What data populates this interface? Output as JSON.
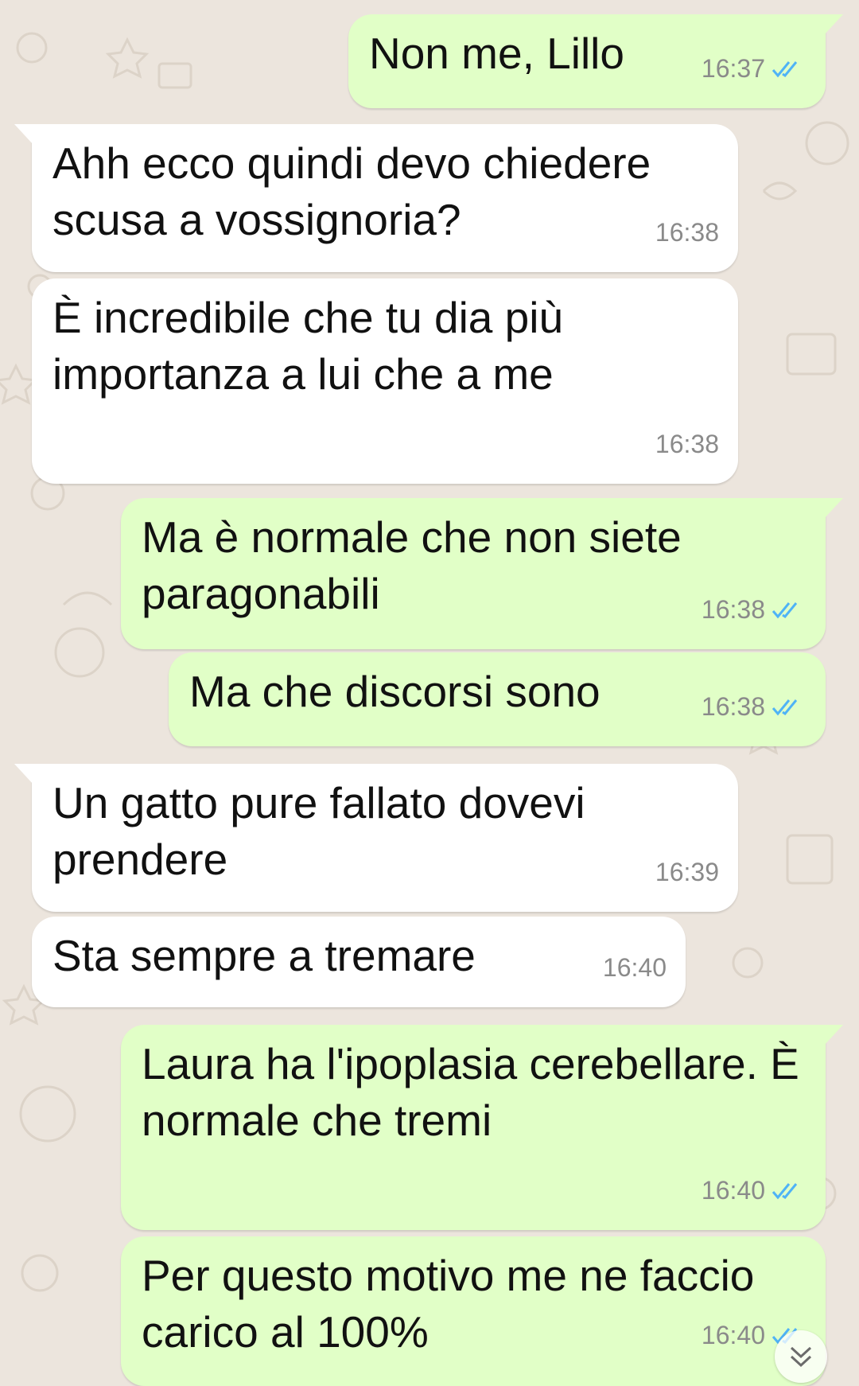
{
  "colors": {
    "wallpaper": "#ece5dd",
    "incoming_bubble": "#ffffff",
    "outgoing_bubble": "#e1ffc7",
    "timestamp": "#8a8a8a",
    "read_ticks": "#4fb3f6"
  },
  "messages": [
    {
      "direction": "outgoing",
      "text": "Non me, Lillo",
      "time": "16:37",
      "status_icon": "double-check-read-icon"
    },
    {
      "direction": "incoming",
      "text": "Ahh ecco quindi devo chiedere scusa a vossignoria?",
      "time": "16:38"
    },
    {
      "direction": "incoming",
      "text": "È incredibile che tu dia più importanza a lui che a me",
      "time": "16:38"
    },
    {
      "direction": "outgoing",
      "text": "Ma è normale che non siete paragonabili",
      "time": "16:38",
      "status_icon": "double-check-read-icon"
    },
    {
      "direction": "outgoing",
      "text": "Ma che discorsi sono",
      "time": "16:38",
      "status_icon": "double-check-read-icon"
    },
    {
      "direction": "incoming",
      "text": "Un gatto pure fallato dovevi prendere",
      "time": "16:39"
    },
    {
      "direction": "incoming",
      "text": "Sta sempre a tremare",
      "time": "16:40"
    },
    {
      "direction": "outgoing",
      "text": "Laura ha l'ipoplasia cerebellare. È normale che tremi",
      "time": "16:40",
      "status_icon": "double-check-read-icon"
    },
    {
      "direction": "outgoing",
      "text": "Per questo motivo me ne faccio carico al 100%",
      "time": "16:40",
      "status_icon": "double-check-read-icon"
    }
  ],
  "scroll_button": {
    "icon": "double-chevron-down-icon"
  }
}
